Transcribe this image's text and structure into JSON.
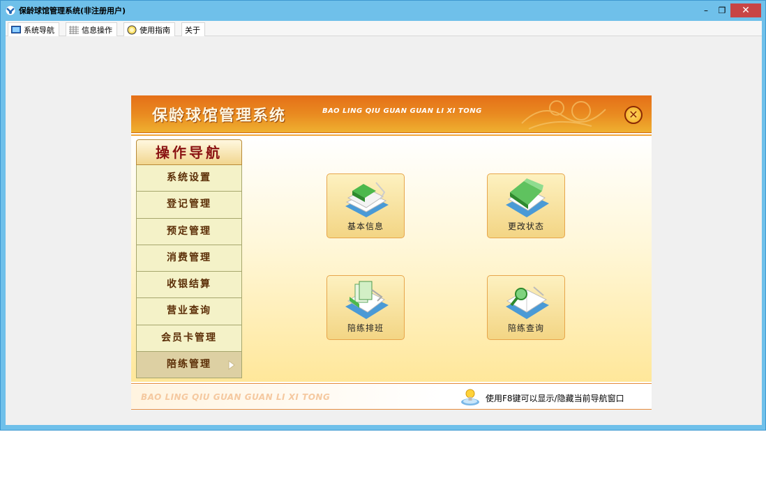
{
  "window": {
    "title": "保龄球馆管理系统(非注册用户)",
    "min_glyph": "–",
    "restore_glyph": "❐",
    "close_glyph": "✕"
  },
  "tabs": [
    {
      "label": "系统导航",
      "icon": "monitor-icon"
    },
    {
      "label": "信息操作",
      "icon": "grid-icon"
    },
    {
      "label": "使用指南",
      "icon": "lightbulb-icon"
    },
    {
      "label": "关于",
      "icon": ""
    }
  ],
  "banner": {
    "title": "保龄球馆管理系统",
    "subtitle": "BAO LING QIU GUAN GUAN LI XI TONG",
    "close_glyph": "✕"
  },
  "nav": {
    "header": "操作导航",
    "items": [
      {
        "label": "系统设置"
      },
      {
        "label": "登记管理"
      },
      {
        "label": "预定管理"
      },
      {
        "label": "消费管理"
      },
      {
        "label": "收银结算"
      },
      {
        "label": "营业查询"
      },
      {
        "label": "会员卡管理"
      },
      {
        "label": "陪练管理",
        "active": true
      }
    ]
  },
  "tiles": [
    {
      "label": "基本信息",
      "icon": "books-icon"
    },
    {
      "label": "更改状态",
      "icon": "folder-icon"
    },
    {
      "label": "陪练排班",
      "icon": "documents-icon"
    },
    {
      "label": "陪练查询",
      "icon": "search-book-icon"
    }
  ],
  "footer": {
    "subtitle": "BAO LING QIU GUAN GUAN LI XI TONG",
    "hint": "使用F8键可以显示/隐藏当前导航窗口"
  },
  "colors": {
    "titlebar": "#6fc0ea",
    "banner": "#e98a20",
    "close": "#c84545"
  }
}
